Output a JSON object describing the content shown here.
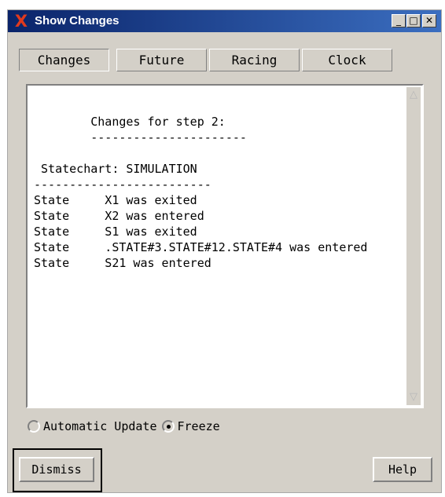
{
  "window": {
    "title": "Show Changes",
    "controls": {
      "minimize": "_",
      "maximize": "□",
      "close": "✕"
    }
  },
  "tabs": [
    {
      "label": "Changes",
      "active": true
    },
    {
      "label": "Future",
      "active": false
    },
    {
      "label": "Racing",
      "active": false
    },
    {
      "label": "Clock",
      "active": false
    }
  ],
  "output": {
    "lines": [
      "        Changes for step 2:",
      "        ----------------------",
      "",
      " Statechart: SIMULATION",
      "-------------------------",
      "State     X1 was exited",
      "State     X2 was entered",
      "State     S1 was exited",
      "State     .STATE#3.STATE#12.STATE#4 was entered",
      "State     S21 was entered"
    ]
  },
  "scrollbar": {
    "up_arrow": "△",
    "down_arrow": "▽"
  },
  "update_mode": {
    "options": [
      {
        "label": "Automatic Update",
        "selected": false
      },
      {
        "label": "Freeze",
        "selected": true
      }
    ]
  },
  "buttons": {
    "dismiss": "Dismiss",
    "help": "Help"
  }
}
